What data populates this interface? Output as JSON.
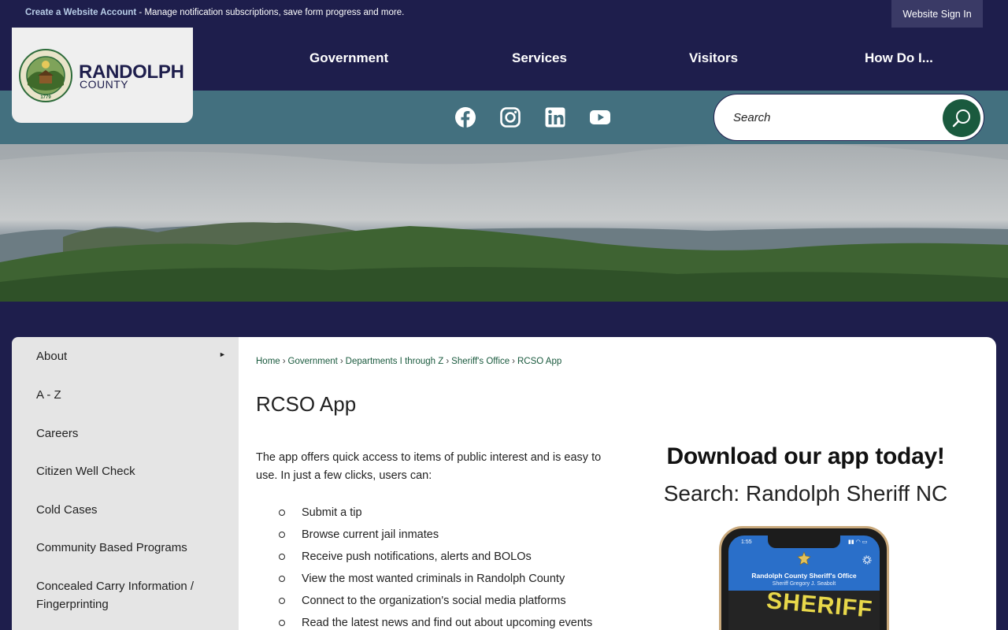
{
  "topbar": {
    "create_link": "Create a Website Account",
    "message": " - Manage notification subscriptions, save form progress and more.",
    "signin": "Website Sign In"
  },
  "logo": {
    "name": "RANDOLPH",
    "subname": "COUNTY",
    "seal_text": "RANDOLPH COUNTY, NORTH CAROLINA",
    "seal_year": "1779"
  },
  "nav": [
    "Government",
    "Services",
    "Visitors",
    "How Do I..."
  ],
  "social": [
    "facebook-icon",
    "instagram-icon",
    "linkedin-icon",
    "youtube-icon"
  ],
  "search": {
    "placeholder": "Search"
  },
  "sidebar": {
    "items": [
      "About",
      "A - Z",
      "Careers",
      "Citizen Well Check",
      "Cold Cases",
      "Community Based Programs",
      "Concealed Carry Information / Fingerprinting"
    ],
    "arrow": "►"
  },
  "breadcrumb": [
    "Home",
    "Government",
    "Departments I through Z",
    "Sheriff's Office",
    "RCSO App"
  ],
  "page": {
    "title": "RCSO App",
    "intro": "The app offers quick access to items of public interest and is easy to use. In just a few clicks, users can:",
    "bullets": [
      "Submit a tip",
      "Browse current jail inmates",
      "Receive push notifications, alerts and BOLOs",
      "View the most wanted criminals in Randolph County",
      "Connect to the organization's social media platforms",
      "Read the latest news and find out about upcoming events"
    ]
  },
  "promo": {
    "title": "Download our app today!",
    "subtitle": "Search: Randolph Sheriff NC",
    "phone_time": "1:55",
    "phone_title": "Randolph County Sheriff's Office",
    "phone_subtitle": "Sheriff Gregory J. Seabolt",
    "phone_banner": "SHERIFF"
  },
  "colors": {
    "navy": "#1e1e4c",
    "teal": "#43707f",
    "green": "#1a5a3e",
    "app_blue": "#2a6fc9"
  }
}
